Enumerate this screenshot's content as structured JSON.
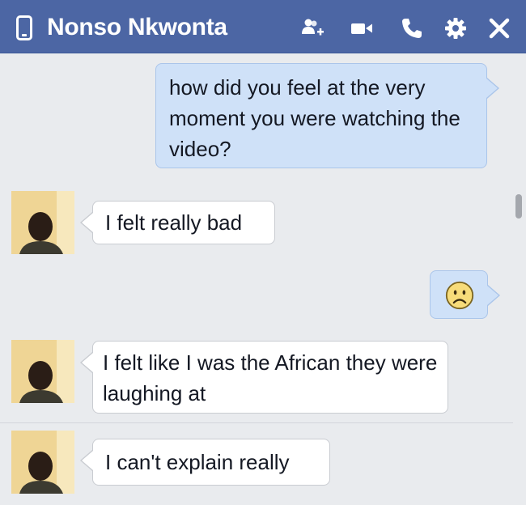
{
  "window": {
    "title": "Nonso Nkwonta",
    "icons": [
      "mobile-phone-icon",
      "add-friend-icon",
      "video-call-icon",
      "phone-call-icon",
      "settings-gear-icon",
      "close-icon"
    ]
  },
  "messages": [
    {
      "direction": "outgoing",
      "text": "how did you feel at the very moment you were watching the video?"
    },
    {
      "direction": "incoming",
      "text": "I felt really bad"
    },
    {
      "direction": "outgoing",
      "emoji": "sad-face-emoji"
    },
    {
      "direction": "incoming",
      "text": "I felt like I was the African they were laughing at"
    },
    {
      "direction": "incoming",
      "text": "I can't explain really"
    }
  ],
  "colors": {
    "header": "#4c66a4",
    "background": "#e9ebee",
    "outgoing_bubble": "#cfe1f8",
    "incoming_bubble": "#ffffff"
  }
}
